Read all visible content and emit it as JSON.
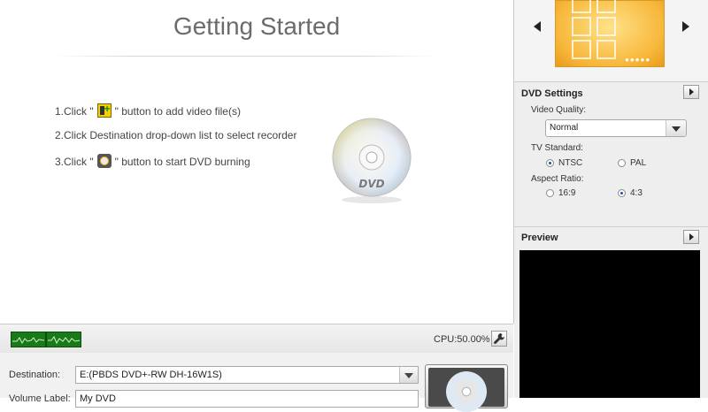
{
  "main": {
    "title": "Getting Started",
    "steps": [
      {
        "pre": "1.Click \"",
        "icon": "add-video-icon",
        "post": "\" button to add video file(s)"
      },
      {
        "text": "2.Click Destination drop-down list to select recorder"
      },
      {
        "pre": "3.Click \"",
        "icon": "burn-dvd-icon",
        "post": "\" button to start DVD burning"
      }
    ],
    "disc_label": "DVD"
  },
  "status": {
    "cpu": "CPU:50.00%",
    "tool_icon": "wrench-icon"
  },
  "bottom": {
    "destination_label": "Destination:",
    "destination_value": "E:(PBDS DVD+-RW DH-16W1S)",
    "volume_label": "Volume Label:",
    "volume_value": "My DVD"
  },
  "right": {
    "template_nav": {
      "left_icon": "arrow-left-icon",
      "right_icon": "arrow-right-icon"
    },
    "dvd_settings": {
      "heading": "DVD Settings",
      "video_quality_label": "Video Quality:",
      "video_quality_value": "Normal",
      "tv_standard_label": "TV Standard:",
      "tv_options": [
        "NTSC",
        "PAL"
      ],
      "tv_selected": "NTSC",
      "aspect_label": "Aspect Ratio:",
      "aspect_options": [
        "16:9",
        "4:3"
      ],
      "aspect_selected": "4:3"
    },
    "preview": {
      "heading": "Preview"
    }
  },
  "colors": {
    "meter_green": "#1a7a1a",
    "template_orange": "#f7b73a",
    "preview_bg": "#000000"
  }
}
